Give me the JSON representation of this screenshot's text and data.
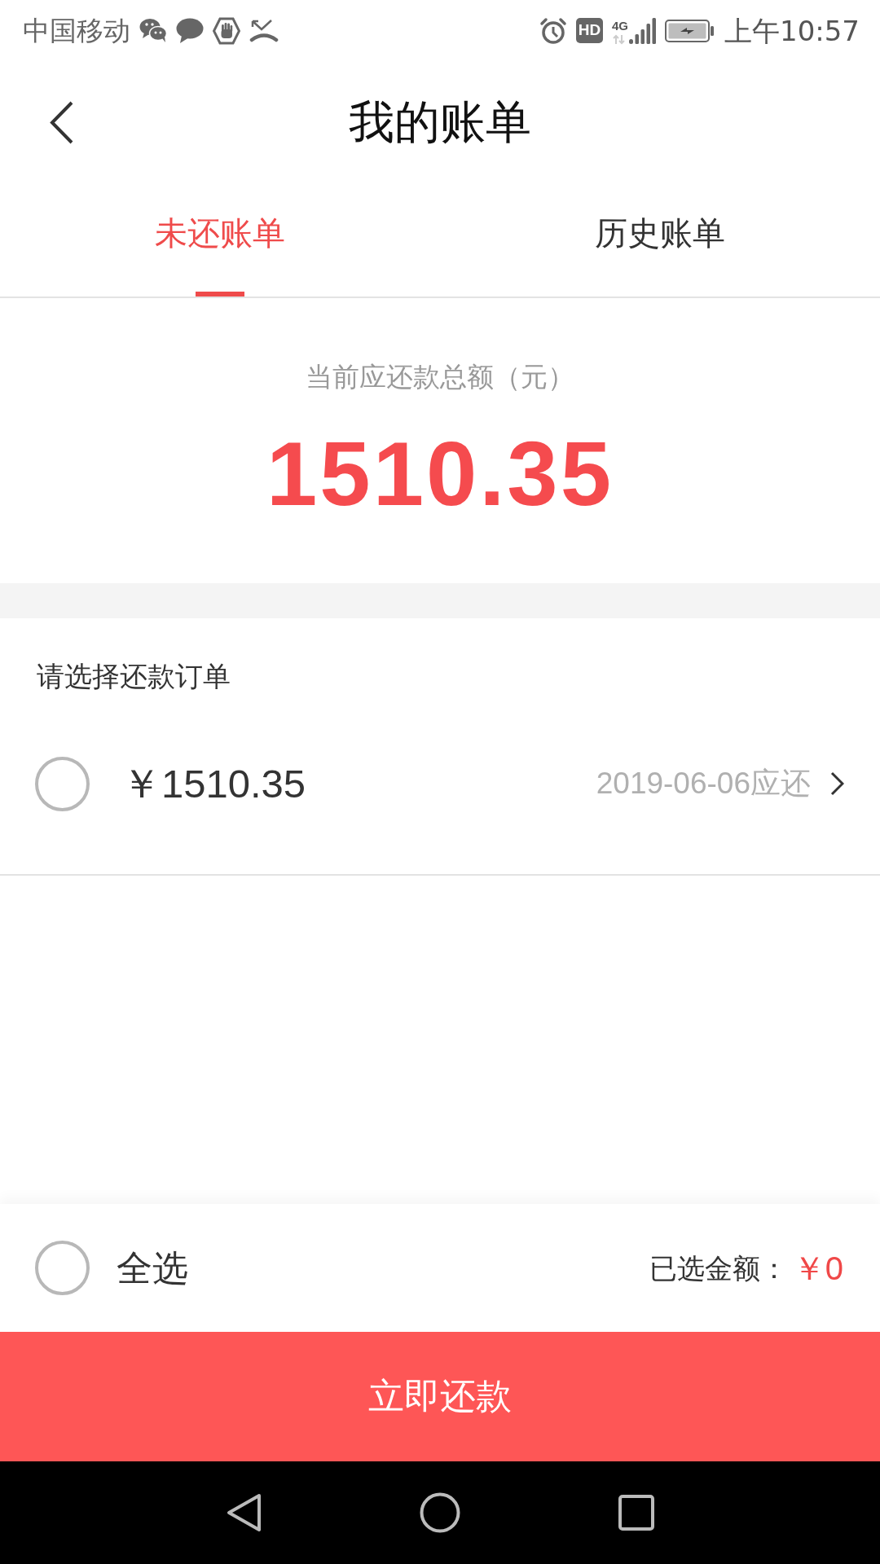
{
  "status_bar": {
    "carrier": "中国移动",
    "hd_label": "HD",
    "network_type": "4G",
    "time": "上午10:57"
  },
  "header": {
    "title": "我的账单"
  },
  "tabs": [
    {
      "label": "未还账单",
      "selected": true
    },
    {
      "label": "历史账单",
      "selected": false
    }
  ],
  "summary": {
    "label": "当前应还款总额（元）",
    "amount": "1510.35"
  },
  "orders": {
    "heading": "请选择还款订单",
    "items": [
      {
        "amount": "￥1510.35",
        "due": "2019-06-06应还",
        "selected": false
      }
    ]
  },
  "footer": {
    "select_all": {
      "label": "全选",
      "selected": false
    },
    "selected_label": "已选金额：",
    "selected_amount": "￥0"
  },
  "pay_button": {
    "label": "立即还款"
  }
}
